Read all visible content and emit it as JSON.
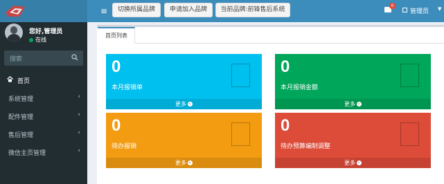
{
  "header": {
    "toolbar_buttons": [
      {
        "label": "切换所属品牌"
      },
      {
        "label": "申请加入品牌"
      },
      {
        "label": "当前品牌:前锋售后系统"
      }
    ],
    "mail_count": "0",
    "user_label": "管理员"
  },
  "colors": {
    "header_bg": "#3c8dbc",
    "logo_bg": "#367fa9",
    "sidebar_bg": "#222d32",
    "online_green": "#00a65a",
    "card_aqua": "#00c0ef",
    "card_green": "#00a65a",
    "card_yellow": "#f39c12",
    "card_red": "#dd4b39"
  },
  "sidebar": {
    "greeting": "您好,管理员",
    "status": "在线",
    "search_placeholder": "搜索",
    "items": [
      {
        "label": "首页",
        "icon": "home-icon"
      },
      {
        "label": "系统管理",
        "icon": "chevron-left-icon"
      },
      {
        "label": "配件管理",
        "icon": "chevron-left-icon"
      },
      {
        "label": "售后管理",
        "icon": "chevron-left-icon"
      },
      {
        "label": "微信主页管理",
        "icon": "chevron-left-icon"
      }
    ]
  },
  "main": {
    "tab": "首页列表",
    "cards": [
      {
        "value": "0",
        "label": "本月报销单",
        "more": "更多"
      },
      {
        "value": "0",
        "label": "本月报销金额",
        "more": "更多"
      },
      {
        "value": "0",
        "label": "待办报销",
        "more": "更多"
      },
      {
        "value": "0",
        "label": "待办预算编制调整",
        "more": "更多"
      }
    ]
  }
}
